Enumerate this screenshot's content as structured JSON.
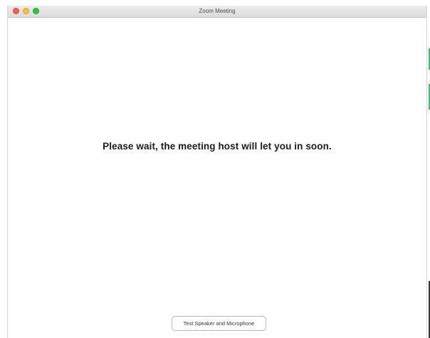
{
  "window": {
    "title": "Zoom Meeting",
    "controls": [
      "close",
      "minimize",
      "zoom"
    ]
  },
  "main": {
    "waiting_message": "Please wait, the meeting host will let you in soon."
  },
  "footer": {
    "test_audio_label": "Test Speaker and Microphone"
  },
  "colors": {
    "close": "#fe5f57",
    "minimize": "#febc2e",
    "zoom": "#28c840",
    "background_accent": "#3fbf6a"
  }
}
